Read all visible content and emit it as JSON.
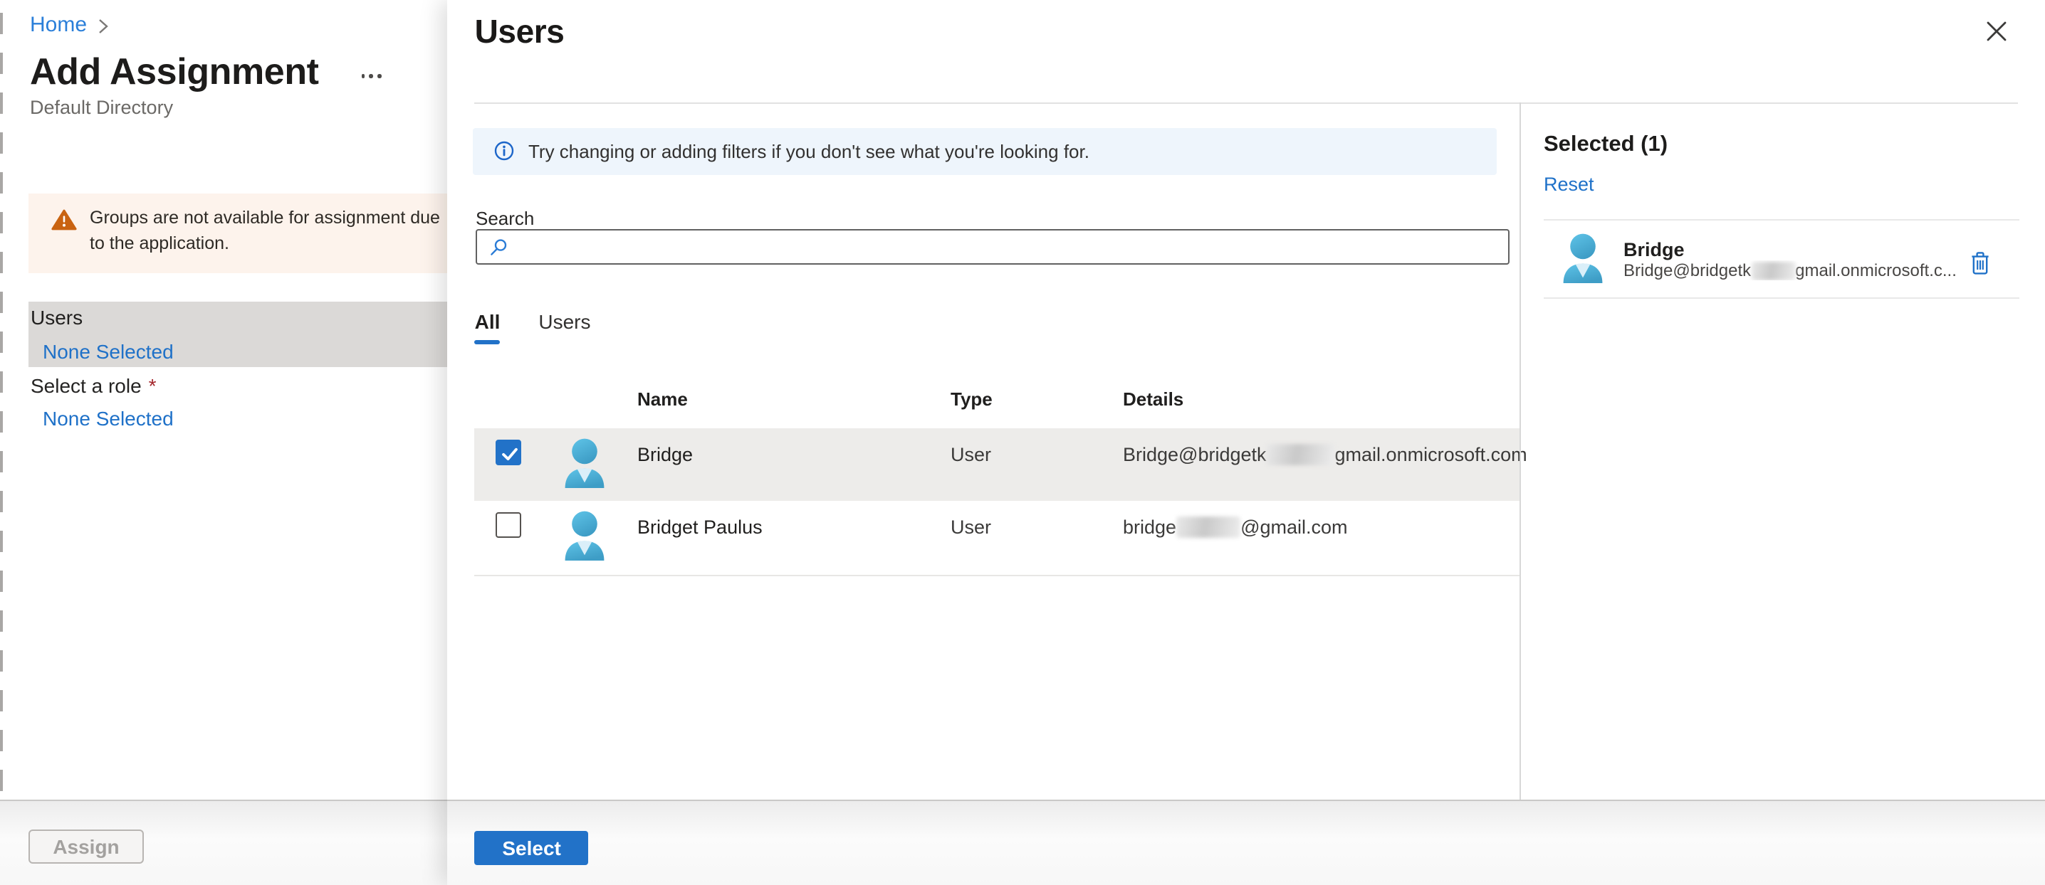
{
  "page": {
    "breadcrumb_home": "Home",
    "title": "Add Assignment",
    "subtitle": "Default Directory"
  },
  "warning": {
    "text": "Groups are not available for assignment due to the application."
  },
  "left_form": {
    "users_label": "Users",
    "users_value": "None Selected",
    "role_label": "Select a role",
    "role_required_mark": "*",
    "role_value": "None Selected"
  },
  "left_footer": {
    "assign_label": "Assign"
  },
  "panel": {
    "title": "Users",
    "info_text": "Try changing or adding filters if you don't see what you're looking for.",
    "search_label": "Search",
    "search_value": "",
    "tabs": [
      {
        "label": "All",
        "active": true
      },
      {
        "label": "Users",
        "active": false
      }
    ],
    "table": {
      "headers": [
        "Name",
        "Type",
        "Details"
      ],
      "rows": [
        {
          "checked": true,
          "name": "Bridge",
          "type": "User",
          "details_prefix": "Bridge@bridgetk",
          "details_redacted": true,
          "details_suffix": "gmail.onmicrosoft.com"
        },
        {
          "checked": false,
          "name": "Bridget Paulus",
          "type": "User",
          "details_prefix": "bridge",
          "details_redacted": true,
          "details_suffix": "@gmail.com"
        }
      ]
    },
    "footer": {
      "select_label": "Select"
    }
  },
  "selected_panel": {
    "title": "Selected (1)",
    "reset_label": "Reset",
    "item": {
      "name": "Bridge",
      "email_prefix": "Bridge@bridgetk",
      "email_redacted": true,
      "email_suffix": "gmail.onmicrosoft.c..."
    }
  },
  "colors": {
    "accent_blue": "#2272c8",
    "link_blue": "#1f71c8",
    "warning_orange": "#c96311",
    "warning_bg": "#fdf3ec",
    "info_bg": "#eef5fc",
    "selected_row_bg": "#edecea",
    "field_highlight_bg": "#dbd9d7",
    "avatar_blue": "#47aed6"
  }
}
